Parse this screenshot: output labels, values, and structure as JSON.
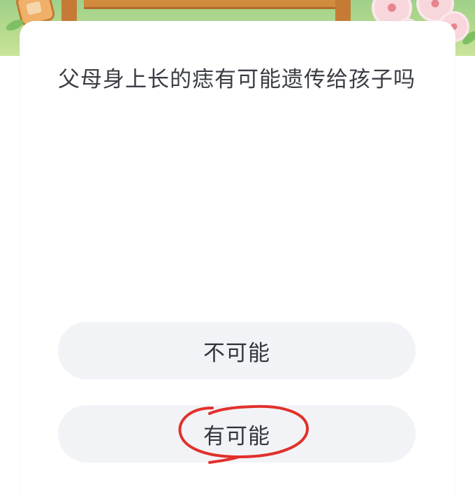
{
  "quiz": {
    "question": "父母身上长的痣有可能遗传给孩子吗",
    "options": [
      {
        "label": "不可能"
      },
      {
        "label": "有可能"
      }
    ],
    "annotation": {
      "marked_option": "有可能",
      "mark_color": "#e2302a"
    }
  },
  "banner": {
    "background_color": "#b8dc8e",
    "flower_color": "#f8d7dc"
  }
}
